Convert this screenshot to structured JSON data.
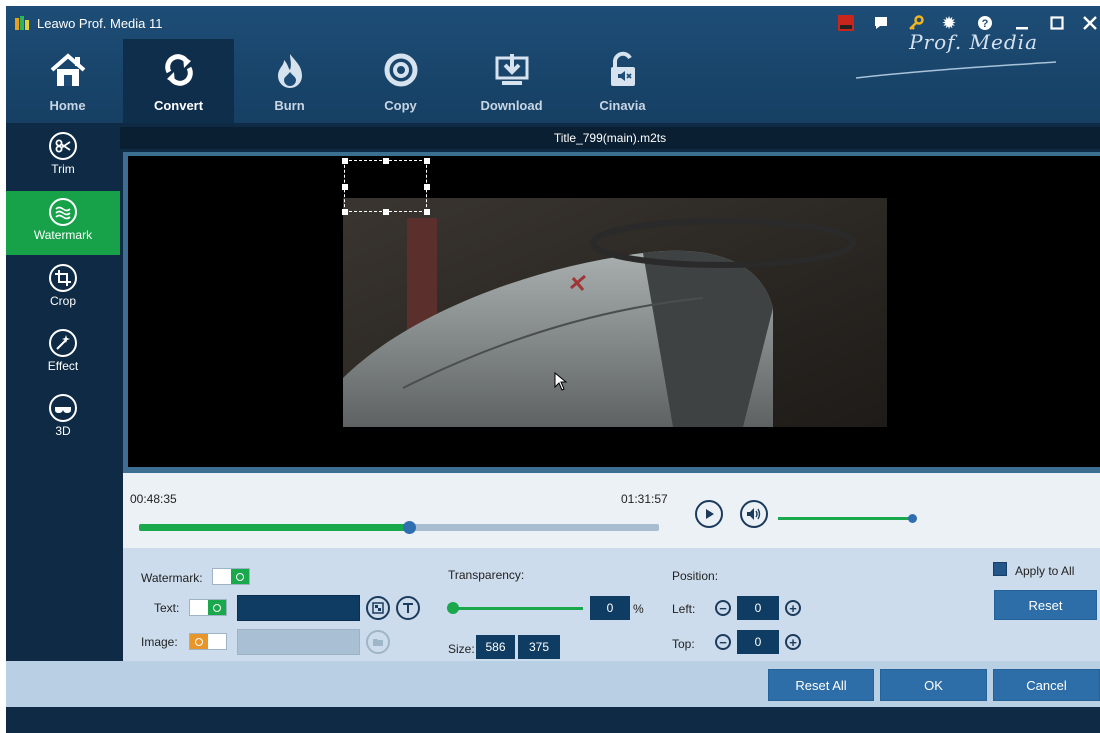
{
  "window": {
    "title": "Leawo Prof. Media 11",
    "controls": [
      "amd-icon",
      "feedback-icon",
      "key-icon",
      "gear-icon",
      "help-icon",
      "minimize-icon",
      "maximize-icon",
      "close-icon"
    ]
  },
  "nav": {
    "items": [
      {
        "label": "Home",
        "icon": "home-icon"
      },
      {
        "label": "Convert",
        "icon": "convert-icon",
        "active": true
      },
      {
        "label": "Burn",
        "icon": "burn-icon"
      },
      {
        "label": "Copy",
        "icon": "copy-icon"
      },
      {
        "label": "Download",
        "icon": "download-icon"
      },
      {
        "label": "Cinavia",
        "icon": "cinavia-icon"
      }
    ],
    "brand": "Prof. Media"
  },
  "sidebar": {
    "items": [
      {
        "label": "Trim",
        "icon": "scissors-icon"
      },
      {
        "label": "Watermark",
        "icon": "watermark-icon",
        "active": true
      },
      {
        "label": "Crop",
        "icon": "crop-icon"
      },
      {
        "label": "Effect",
        "icon": "effect-icon"
      },
      {
        "label": "3D",
        "icon": "3d-glasses-icon"
      }
    ]
  },
  "preview": {
    "file_title": "Title_799(main).m2ts"
  },
  "playback": {
    "time_start": "00:48:35",
    "time_end": "01:31:57",
    "progress_fraction": 0.52,
    "volume_fraction": 1.0
  },
  "watermark": {
    "watermark_label": "Watermark:",
    "text_label": "Text:",
    "text_value": "",
    "image_label": "Image:",
    "transparency_label": "Transparency:",
    "transparency_value": "0",
    "transparency_unit": "%",
    "size_label": "Size:",
    "size_width": "586",
    "size_height": "375",
    "position_label": "Position:",
    "left_label": "Left:",
    "left_value": "0",
    "top_label": "Top:",
    "top_value": "0",
    "apply_all_label": "Apply to All",
    "reset_label": "Reset"
  },
  "footer": {
    "reset_all_label": "Reset All",
    "ok_label": "OK",
    "cancel_label": "Cancel"
  },
  "colors": {
    "accent_green": "#19a84b",
    "nav_blue": "#1d4d76",
    "dark_navy": "#0e2a44",
    "button_blue": "#2d6da8"
  }
}
